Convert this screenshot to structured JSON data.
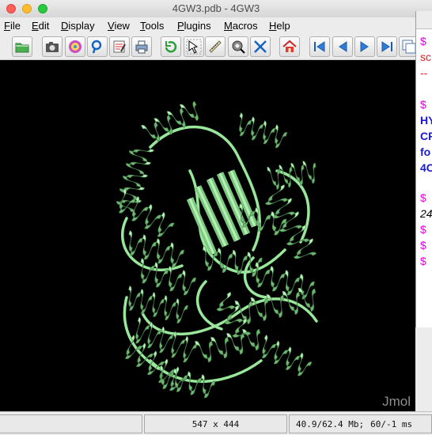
{
  "window": {
    "title": "4GW3.pdb - 4GW3"
  },
  "menu": [
    {
      "label": "File",
      "mnemonic": "F",
      "rest": "ile"
    },
    {
      "label": "Edit",
      "mnemonic": "E",
      "rest": "dit"
    },
    {
      "label": "Display",
      "mnemonic": "D",
      "rest": "isplay"
    },
    {
      "label": "View",
      "mnemonic": "V",
      "rest": "iew"
    },
    {
      "label": "Tools",
      "mnemonic": "T",
      "rest": "ools"
    },
    {
      "label": "Plugins",
      "mnemonic": "P",
      "rest": "lugins"
    },
    {
      "label": "Macros",
      "mnemonic": "M",
      "rest": "acros"
    },
    {
      "label": "Help",
      "mnemonic": "H",
      "rest": "elp"
    }
  ],
  "toolbar": {
    "buttons": [
      {
        "icon": "open-folder-icon"
      },
      {
        "icon": "camera-icon"
      },
      {
        "icon": "povray-icon"
      },
      {
        "icon": "pdf-icon"
      },
      {
        "icon": "script-editor-icon"
      },
      {
        "icon": "print-icon"
      },
      {
        "icon": "rotate-icon"
      },
      {
        "icon": "pick-icon"
      },
      {
        "icon": "measure-ruler-icon"
      },
      {
        "icon": "spin-icon"
      },
      {
        "icon": "center-icon"
      },
      {
        "icon": "home-icon"
      },
      {
        "icon": "first-frame-icon"
      },
      {
        "icon": "previous-frame-icon"
      },
      {
        "icon": "next-frame-icon"
      },
      {
        "icon": "last-frame-icon"
      },
      {
        "icon": "console-icon"
      }
    ]
  },
  "viewer": {
    "watermark": "Jmol",
    "background_color": "#000000",
    "cartoon_color": "#98e79a"
  },
  "console": {
    "lines": [
      {
        "text": "$",
        "color": "#e000e0",
        "bold": false,
        "italic": false
      },
      {
        "text": "sc",
        "color": "#e02020",
        "bold": false,
        "italic": false
      },
      {
        "text": "--",
        "color": "#e02020",
        "bold": false,
        "italic": false
      },
      {
        "text": "$",
        "color": "#e000e0",
        "bold": false,
        "italic": false
      },
      {
        "text": "HY",
        "color": "#1a1ad0",
        "bold": true,
        "italic": false
      },
      {
        "text": "CF",
        "color": "#1a1ad0",
        "bold": true,
        "italic": false
      },
      {
        "text": "fo",
        "color": "#1a1ad0",
        "bold": true,
        "italic": false
      },
      {
        "text": "4C",
        "color": "#1a1ad0",
        "bold": true,
        "italic": false
      },
      {
        "text": "$",
        "color": "#e000e0",
        "bold": false,
        "italic": false
      },
      {
        "text": "24",
        "color": "#000000",
        "bold": false,
        "italic": true
      },
      {
        "text": "$",
        "color": "#e000e0",
        "bold": false,
        "italic": false
      },
      {
        "text": "$",
        "color": "#e000e0",
        "bold": false,
        "italic": false
      },
      {
        "text": "$",
        "color": "#e000e0",
        "bold": false,
        "italic": false
      }
    ]
  },
  "status": {
    "left": "",
    "size": "547 x 444",
    "memory": "40.9/62.4 Mb;",
    "fps": "60/-1 ms"
  }
}
